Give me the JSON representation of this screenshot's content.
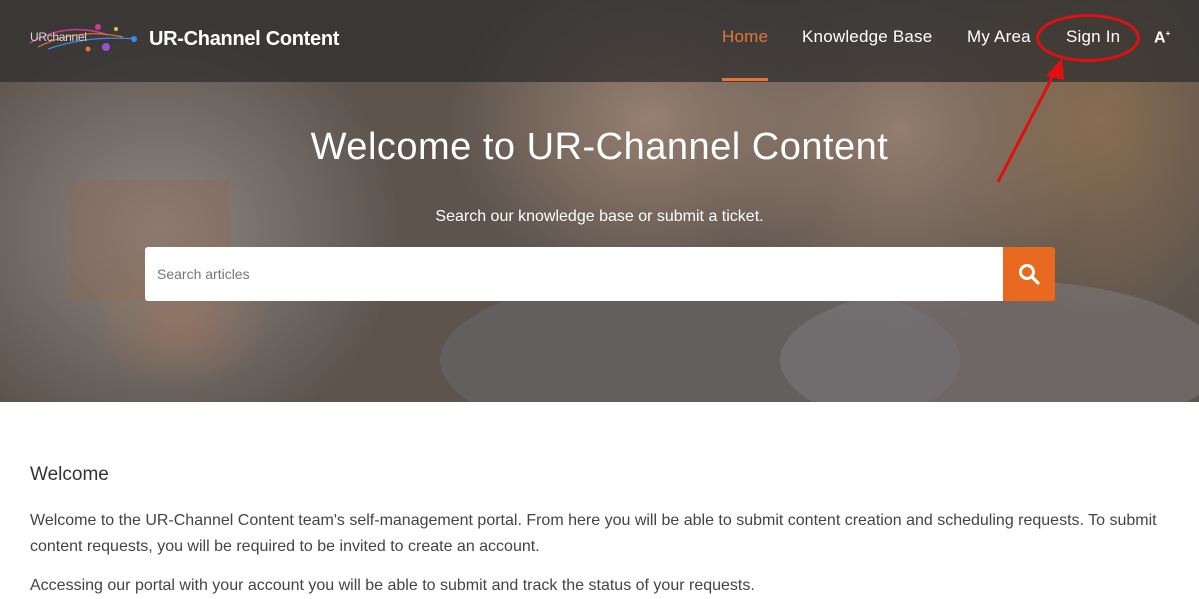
{
  "header": {
    "logo_text": "URchannel",
    "brand": "UR-Channel Content",
    "nav": [
      {
        "label": "Home",
        "active": true
      },
      {
        "label": "Knowledge Base",
        "active": false
      },
      {
        "label": "My Area",
        "active": false
      },
      {
        "label": "Sign In",
        "active": false
      }
    ],
    "font_size_label": "A",
    "font_size_sup": "+"
  },
  "hero": {
    "title": "Welcome to UR-Channel Content",
    "subtitle": "Search our knowledge base or submit a ticket.",
    "search_placeholder": "Search articles",
    "search_icon": "search-icon"
  },
  "content": {
    "heading": "Welcome",
    "paragraphs": [
      "Welcome to the UR-Channel Content team's self-management portal. From here you will be able to submit content creation and scheduling requests. To submit content requests, you will be required to be invited to create an account.",
      "Accessing our portal with your account you will be able to submit and track the status of your requests."
    ]
  },
  "colors": {
    "accent": "#e8733a",
    "search_button": "#e8691f",
    "annotation": "#e01010"
  }
}
